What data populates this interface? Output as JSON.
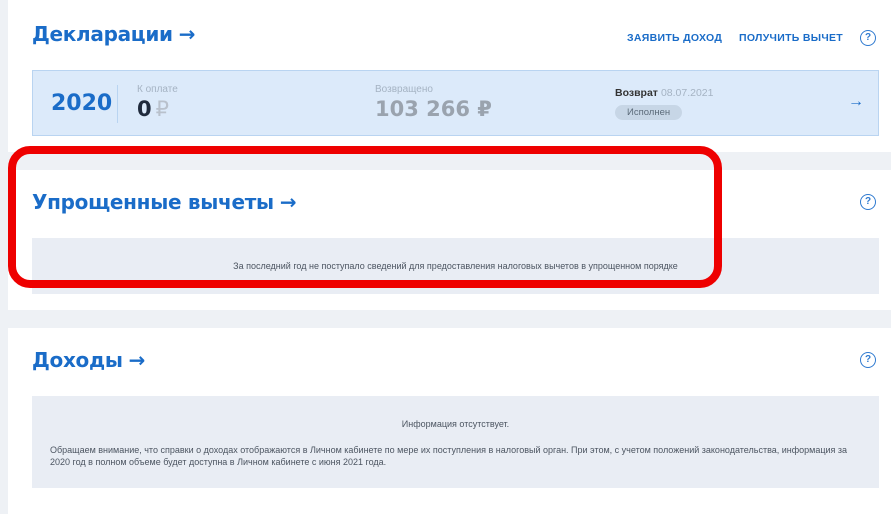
{
  "declarations": {
    "title": "Декларации",
    "arrow": "→",
    "link_income": "ЗАЯВИТЬ ДОХОД",
    "link_deduction": "ПОЛУЧИТЬ ВЫЧЕТ",
    "help": "?",
    "row": {
      "year": "2020",
      "to_pay_label": "К оплате",
      "to_pay_value": "0",
      "currency": "₽",
      "returned_label": "Возвращено",
      "returned_value": "103 266 ₽",
      "return_label": "Возврат",
      "return_date": "08.07.2021",
      "status": "Исполнен",
      "arrow": "→"
    }
  },
  "simplified": {
    "title": "Упрощенные вычеты",
    "arrow": "→",
    "help": "?",
    "message": "За последний год не поступало сведений для предоставления налоговых вычетов в упрощенном порядке"
  },
  "income": {
    "title": "Доходы",
    "arrow": "→",
    "help": "?",
    "head": "Информация отсутствует.",
    "body": "Обращаем внимание, что справки о доходах отображаются в Личном кабинете по мере их поступления в налоговый орган. При этом, с учетом положений законодательства, информация за 2020 год в полном объеме будет доступна в Личном кабинете с июня 2021 года."
  },
  "colors": {
    "accent": "#1a6cc8",
    "highlight": "#ee0000",
    "row_bg": "#dceafa",
    "info_bg": "#e9edf4"
  }
}
